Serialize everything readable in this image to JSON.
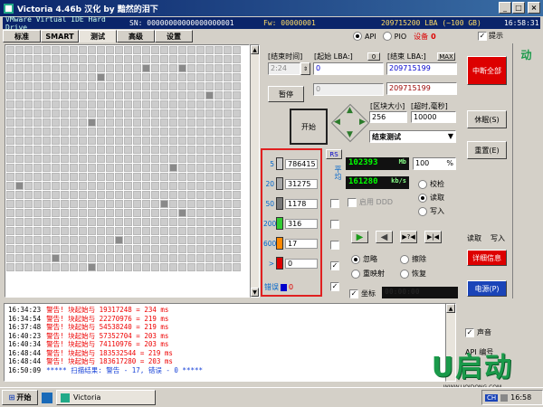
{
  "window": {
    "title": "Victoria 4.46b 汉化 by 黯然的泪下",
    "min": "_",
    "max": "□",
    "close": "×"
  },
  "status": {
    "drive": "VMware Virtual IDE Hard Drive",
    "sn": "SN: 00000000000000000001",
    "fw": "Fw: 00000001",
    "lba": "209715200 LBA (~100 GB)",
    "time": "16:58:31"
  },
  "tabs": [
    "标准",
    "SMART",
    "测试",
    "高级",
    "设置"
  ],
  "mode": {
    "api": "API",
    "pio": "PIO",
    "device_label": "设备",
    "device_value": "0",
    "hint": "提示"
  },
  "test": {
    "end_time_label": "[结束时间]",
    "end_time_value": "2:24",
    "start_lba_label": "[起始 LBA:]",
    "start_lba_btn": "0",
    "start_lba_value": "0",
    "end_lba_label": "[结束 LBA:]",
    "end_lba_btn": "MAX",
    "end_lba_value": "209715199",
    "end_lba_value2": "209715199",
    "mid_value": "0",
    "pause": "暂停",
    "start": "开始",
    "block_size_label": "[区块大小]",
    "block_size_value": "256",
    "timeout_label": "[超时,毫秒]",
    "timeout_value": "10000",
    "end_action": "结束测试",
    "rs": "RS",
    "vertical_label": "平均"
  },
  "legend": [
    {
      "num": "5",
      "count": "786415",
      "color": "#c8c8c8"
    },
    {
      "num": "20",
      "count": "31275",
      "color": "#a8a8a8"
    },
    {
      "num": "50",
      "count": "1178",
      "color": "#787878"
    },
    {
      "num": "200",
      "count": "316",
      "color": "#33cc33"
    },
    {
      "num": "600",
      "count": "17",
      "color": "#ff8800"
    },
    {
      "num": ">",
      "count": "0",
      "color": "#dd0000"
    }
  ],
  "error_label": "错误",
  "error_count": "0",
  "speed": {
    "mb": "102393",
    "mb_unit": "Mb",
    "pct": "100",
    "pct_unit": "%",
    "kbs": "161280",
    "kbs_unit": "kb/s",
    "ddd": "启用 DDD"
  },
  "ops": {
    "verify": "校检",
    "read": "读取",
    "write": "写入"
  },
  "actions": {
    "ignore": "忽略",
    "erase": "擦除",
    "remap": "重映射",
    "restore": "恢复"
  },
  "coord": {
    "label": "坐标",
    "value": "00:00:00"
  },
  "right_panel": {
    "abort": "中断全部",
    "sleep": "休眠(S)",
    "reset": "重置(E)",
    "read": "读取",
    "write": "写入",
    "details": "详细信息",
    "power": "电源(P)",
    "sound": "声音",
    "api_num": "API 编号"
  },
  "log": [
    {
      "time": "16:34:23",
      "msg": "警告! 块起始与 19317248 = 234 ms"
    },
    {
      "time": "16:34:54",
      "msg": "警告! 块起始与 22270976 = 219 ms"
    },
    {
      "time": "16:37:48",
      "msg": "警告! 块起始与 54538240 = 219 ms"
    },
    {
      "time": "16:40:23",
      "msg": "警告! 块起始与 57352704 = 203 ms"
    },
    {
      "time": "16:40:34",
      "msg": "警告! 块起始与 74110976 = 203 ms"
    },
    {
      "time": "16:48:44",
      "msg": "警告! 块起始与 183532544 = 219 ms"
    },
    {
      "time": "16:48:44",
      "msg": "警告! 块起始与 183617280 = 203 ms"
    },
    {
      "time": "16:50:09",
      "msg": "***** 扫描结果: 警告 - 17, 错误 - 0 *****"
    }
  ],
  "brand": {
    "logo": "U启动",
    "url": "WWW.UQIDONG.COM"
  },
  "taskbar": {
    "start": "开始",
    "app": "Victoria",
    "time": "16:58",
    "lang": "CH"
  }
}
